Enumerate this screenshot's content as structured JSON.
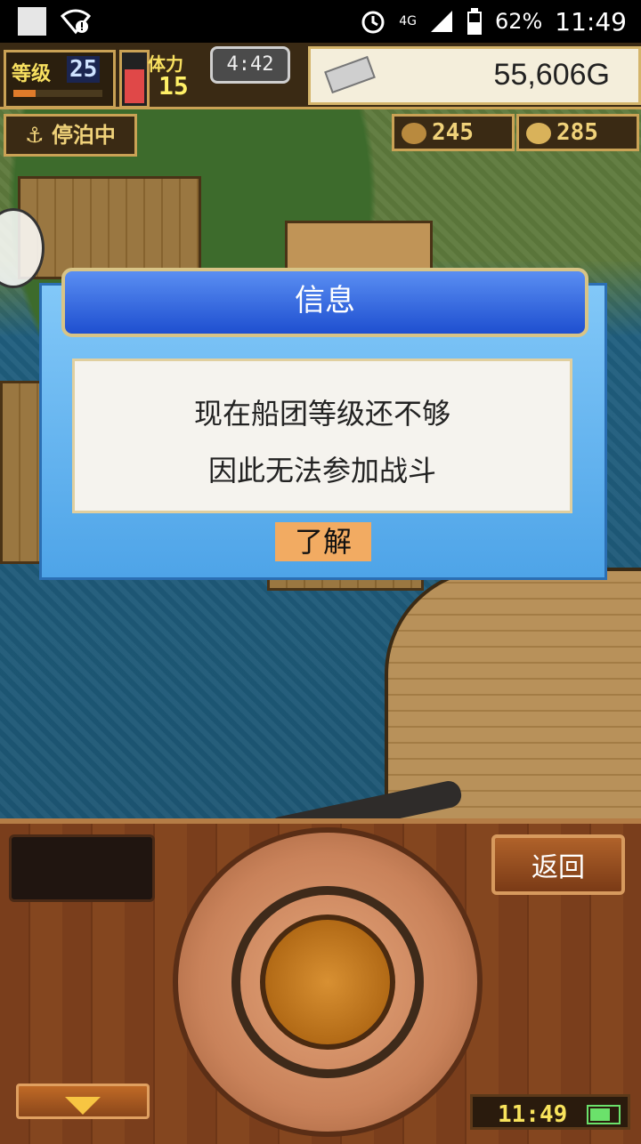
{
  "status_bar": {
    "network": "4G",
    "battery_percent": "62%",
    "time": "11:49"
  },
  "hud": {
    "level_label": "等级",
    "level_value": "25",
    "level_progress": 0.25,
    "stamina_label": "体力",
    "stamina_value": "15",
    "stamina_fill": 0.7,
    "timer": "4:42",
    "gold": "55,606G",
    "dock_status": "停泊中",
    "resource_1": "245",
    "resource_2": "285"
  },
  "dialog": {
    "title": "信息",
    "line1": "现在船团等级还不够",
    "line2": "因此无法参加战斗",
    "ok_label": "了解"
  },
  "console": {
    "back_label": "返回",
    "clock": "11:49",
    "battery_level": 0.8
  },
  "colors": {
    "dialog_title_bg": "#1e4fd0",
    "dialog_bg": "#4ea4e8",
    "ok_button": "#f2ab62"
  }
}
